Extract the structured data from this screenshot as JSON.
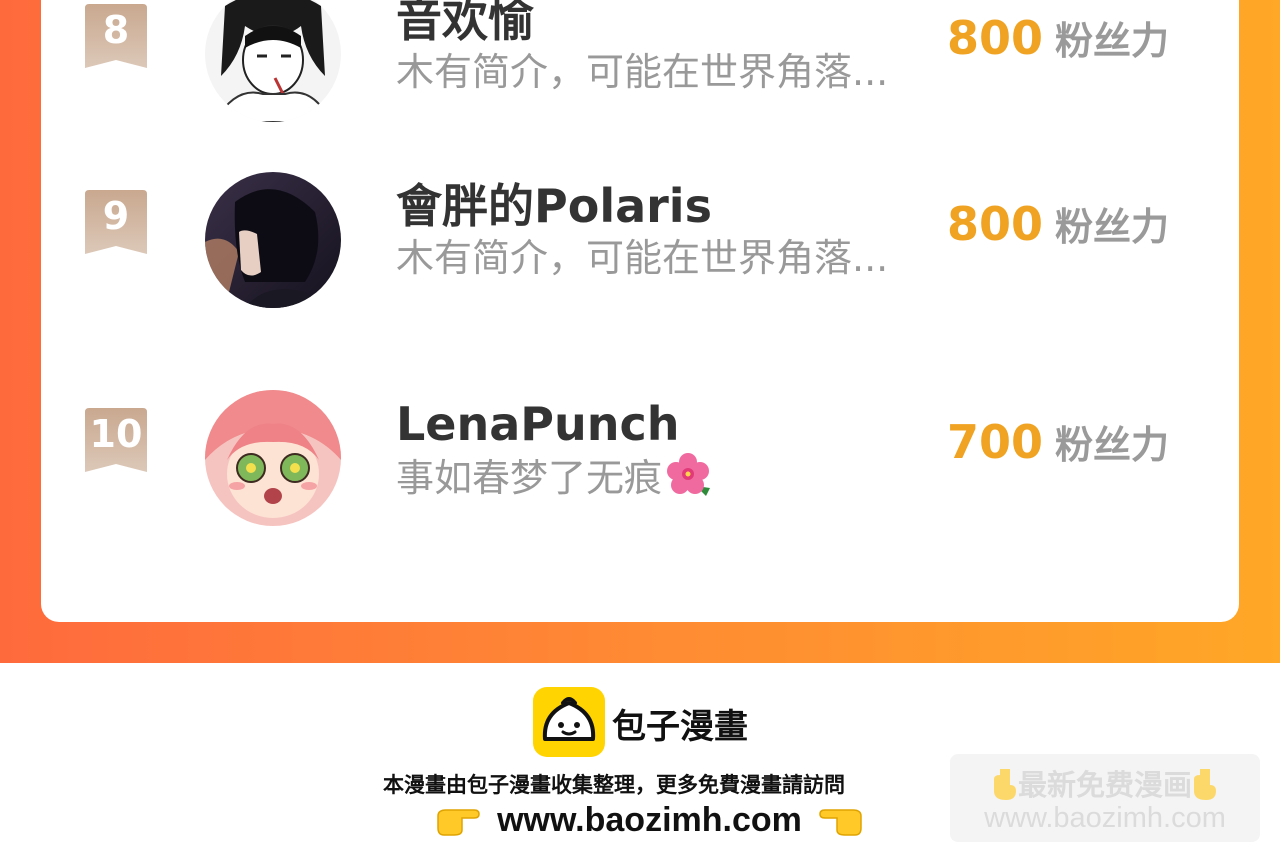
{
  "ranking": {
    "items": [
      {
        "rank": "8",
        "name": "音欢愉",
        "bio": "木有简介，可能在世界角落...",
        "fans": "800",
        "fans_unit": "粉丝力",
        "avatar": "manga-girl-avatar"
      },
      {
        "rank": "9",
        "name": "會胖的Polaris",
        "bio": "木有简介，可能在世界角落...",
        "fans": "800",
        "fans_unit": "粉丝力",
        "avatar": "dark-profile-boy-avatar"
      },
      {
        "rank": "10",
        "name": "LenaPunch",
        "bio": "事如春梦了无痕",
        "bio_emoji": "hibiscus-icon",
        "fans": "700",
        "fans_unit": "粉丝力",
        "avatar": "pink-hair-anime-girl-avatar"
      }
    ]
  },
  "footer": {
    "brand": "包子漫畫",
    "tagline": "本漫畫由包子漫畫收集整理，更多免費漫畫請訪問",
    "site": "www.baozimh.com",
    "watermark_title": "最新免费漫画",
    "watermark_url": "www.baozimh.com"
  },
  "colors": {
    "banner_start": "#ff6a3d",
    "banner_end": "#ffa726",
    "fans_number": "#f0a322",
    "rank_badge": "#d2b59c"
  }
}
